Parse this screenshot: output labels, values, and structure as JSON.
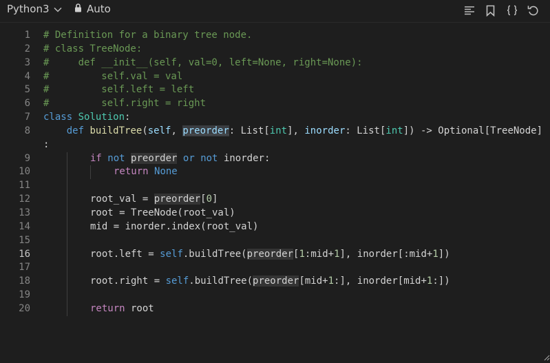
{
  "toolbar": {
    "language": "Python3",
    "mode": "Auto",
    "icons": [
      "format-icon",
      "bookmark-icon",
      "braces-icon",
      "reset-icon"
    ]
  },
  "editor": {
    "active_line": "16",
    "line_numbers": [
      "1",
      "2",
      "3",
      "4",
      "5",
      "6",
      "7",
      "8",
      "9",
      "10",
      "11",
      "12",
      "13",
      "14",
      "15",
      "16",
      "17",
      "18",
      "19",
      "20"
    ],
    "lines": {
      "l1": "# Definition for a binary tree node.",
      "l2": "# class TreeNode:",
      "l3": "#     def __init__(self, val=0, left=None, right=None):",
      "l4": "#         self.val = val",
      "l5": "#         self.left = left",
      "l6": "#         self.right = right",
      "l7_kw": "class",
      "l7_name": "Solution",
      "l7_colon": ":",
      "l8_def": "def",
      "l8_fn": "buildTree",
      "l8_self": "self",
      "l8_p1": "preorder",
      "l8_t1": "List",
      "l8_int1": "int",
      "l8_p2": "inorder",
      "l8_t2": "List",
      "l8_int2": "int",
      "l8_ret": "Optional",
      "l8_tn": "TreeNode",
      "l8_wrap": ":",
      "l9_if": "if",
      "l9_not1": "not",
      "l9_pre": "preorder",
      "l9_or": "or",
      "l9_not2": "not",
      "l9_in": "inorder",
      "l10_ret": "return",
      "l10_none": "None",
      "l12_a": "root_val = ",
      "l12_pre": "preorder",
      "l12_b": "[",
      "l12_n": "0",
      "l12_c": "]",
      "l13": "root = TreeNode(root_val)",
      "l14": "mid = inorder.index(root_val)",
      "l16_a": "root.left = ",
      "l16_self": "self",
      "l16_b": ".buildTree(",
      "l16_pre": "preorder",
      "l16_c": "[",
      "l16_n1": "1",
      "l16_d": ":mid+",
      "l16_n2": "1",
      "l16_e": "], inorder[:mid+",
      "l16_n3": "1",
      "l16_f": "])",
      "l18_a": "root.right = ",
      "l18_self": "self",
      "l18_b": ".buildTree(",
      "l18_pre": "preorder",
      "l18_c": "[mid+",
      "l18_n1": "1",
      "l18_d": ":], inorder[mid+",
      "l18_n2": "1",
      "l18_e": ":])",
      "l20_ret": "return",
      "l20_b": " root"
    }
  },
  "colors": {
    "background": "#1e1e1e",
    "comment": "#6a9955",
    "keyword": "#569cd6",
    "class_name": "#4ec9b0",
    "control": "#c586c0",
    "number": "#b5cea8"
  }
}
